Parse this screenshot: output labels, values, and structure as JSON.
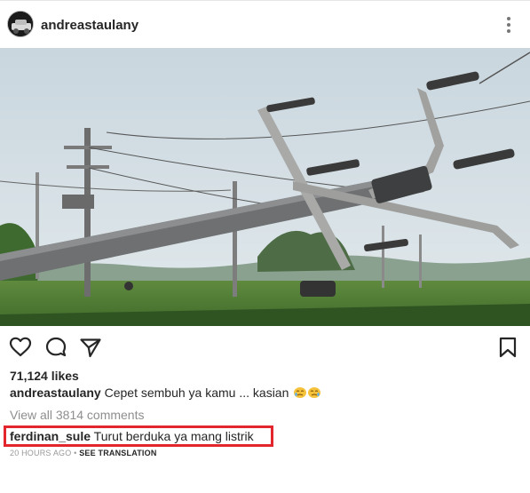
{
  "post": {
    "username": "andreastaulany",
    "likes": "71,124 likes",
    "caption_user": "andreastaulany",
    "caption_text": "Cepet sembuh ya kamu ... kasian",
    "caption_emoji": [
      "crying-face",
      "crying-face"
    ],
    "view_all_comments": "View all 3814 comments",
    "comment": {
      "user": "ferdinan_sule",
      "text": "Turut berduka ya mang listrik"
    },
    "timestamp": "20 HOURS AGO",
    "separator": "•",
    "see_translation": "SEE TRANSLATION"
  },
  "icons": {
    "like": "heart-icon",
    "comment": "comment-icon",
    "share": "share-icon",
    "save": "bookmark-icon",
    "more": "more-vertical-icon"
  },
  "colors": {
    "text": "#262626",
    "muted": "#8e8e8e",
    "highlight_border": "#e3262e"
  }
}
